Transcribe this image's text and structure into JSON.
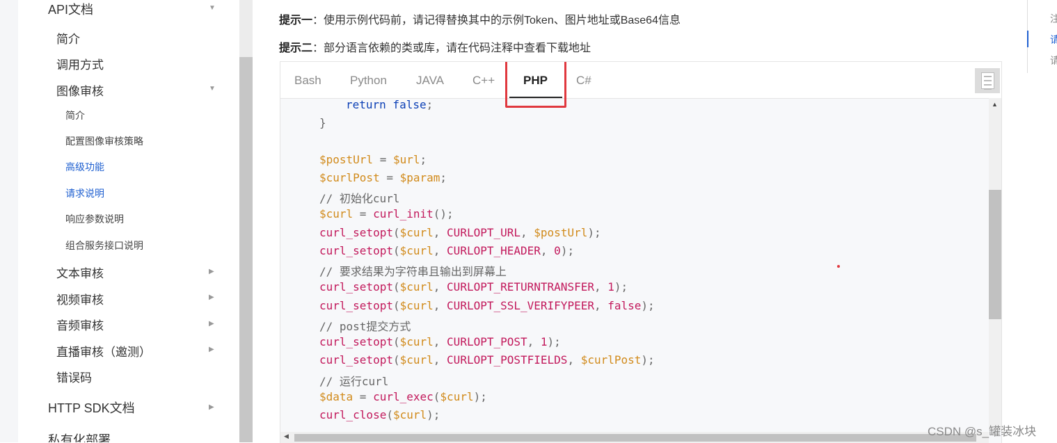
{
  "sidebar": {
    "items": [
      {
        "label": "API文档"
      },
      {
        "label": "简介"
      },
      {
        "label": "调用方式"
      },
      {
        "label": "图像审核"
      },
      {
        "label": "简介"
      },
      {
        "label": "配置图像审核策略"
      },
      {
        "label": "高级功能"
      },
      {
        "label": "请求说明"
      },
      {
        "label": "响应参数说明"
      },
      {
        "label": "组合服务接口说明"
      },
      {
        "label": "文本审核"
      },
      {
        "label": "视频审核"
      },
      {
        "label": "音频审核"
      },
      {
        "label": "直播审核（邀测）"
      },
      {
        "label": "错误码"
      },
      {
        "label": "HTTP SDK文档"
      },
      {
        "label": "私有化部署"
      }
    ]
  },
  "tips": [
    {
      "label": "提示一",
      "text": "：使用示例代码前，请记得替换其中的示例Token、图片地址或Base64信息"
    },
    {
      "label": "提示二",
      "text": "：部分语言依赖的类或库，请在代码注释中查看下载地址"
    }
  ],
  "tabs": [
    "Bash",
    "Python",
    "JAVA",
    "C++",
    "PHP",
    "C#"
  ],
  "selected_tab": "PHP",
  "code": {
    "l1": {
      "a": "return",
      "b": " false",
      "c": ";"
    },
    "l2": "}",
    "l3": {
      "a": "$postUrl",
      "b": " = ",
      "c": "$url",
      "d": ";"
    },
    "l4": {
      "a": "$curlPost",
      "b": " = ",
      "c": "$param",
      "d": ";"
    },
    "l5": "// 初始化curl",
    "l6": {
      "a": "$curl",
      "b": " = ",
      "c": "curl_init",
      "d": "();"
    },
    "l7": {
      "a": "curl_setopt",
      "b": "(",
      "c": "$curl",
      "d": ", ",
      "e": "CURLOPT_URL",
      "f": ", ",
      "g": "$postUrl",
      "h": ");"
    },
    "l8": {
      "a": "curl_setopt",
      "b": "(",
      "c": "$curl",
      "d": ", ",
      "e": "CURLOPT_HEADER",
      "f": ", ",
      "g": "0",
      "h": ");"
    },
    "l9": "// 要求结果为字符串且输出到屏幕上",
    "l10": {
      "a": "curl_setopt",
      "b": "(",
      "c": "$curl",
      "d": ", ",
      "e": "CURLOPT_RETURNTRANSFER",
      "f": ", ",
      "g": "1",
      "h": ");"
    },
    "l11": {
      "a": "curl_setopt",
      "b": "(",
      "c": "$curl",
      "d": ", ",
      "e": "CURLOPT_SSL_VERIFYPEER",
      "f": ", ",
      "g": "false",
      "h": ");"
    },
    "l12": "// post提交方式",
    "l13": {
      "a": "curl_setopt",
      "b": "(",
      "c": "$curl",
      "d": ", ",
      "e": "CURLOPT_POST",
      "f": ", ",
      "g": "1",
      "h": ");"
    },
    "l14": {
      "a": "curl_setopt",
      "b": "(",
      "c": "$curl",
      "d": ", ",
      "e": "CURLOPT_POSTFIELDS",
      "f": ", ",
      "g": "$curlPost",
      "h": ");"
    },
    "l15": "// 运行curl",
    "l16": {
      "a": "$data",
      "b": " = ",
      "c": "curl_exec",
      "d": "(",
      "e": "$curl",
      "f": ");"
    },
    "l17": {
      "a": "curl_close",
      "b": "(",
      "c": "$curl",
      "d": ");"
    }
  },
  "right_toc": [
    "注",
    "请",
    "请"
  ],
  "watermark": "CSDN @s_罐装冰块",
  "colors": {
    "accent": "#1e5fd0",
    "highlight": "#e0383e",
    "variable": "#d18a1a",
    "function": "#c2185b",
    "keyword": "#0b3fb5"
  }
}
